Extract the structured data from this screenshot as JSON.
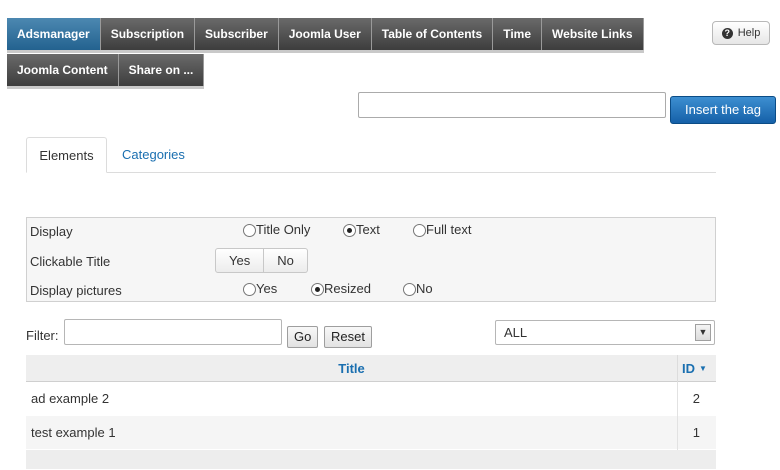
{
  "plugin_tabs": {
    "row1": [
      "Adsmanager",
      "Subscription",
      "Subscriber",
      "Joomla User",
      "Table of Contents",
      "Time",
      "Website Links"
    ],
    "row2": [
      "Joomla Content",
      "Share on ..."
    ],
    "active": "Adsmanager"
  },
  "help": {
    "label": "Help",
    "icon": "question-icon"
  },
  "tag_input": {
    "value": "",
    "placeholder": ""
  },
  "insert_button": {
    "label": "Insert the tag"
  },
  "subtabs": {
    "elements": "Elements",
    "categories": "Categories"
  },
  "options": {
    "display": {
      "label": "Display",
      "choices": [
        "Title Only",
        "Text",
        "Full text"
      ],
      "selected": "Text"
    },
    "clickable_title": {
      "label": "Clickable Title",
      "yes": "Yes",
      "no": "No"
    },
    "display_pictures": {
      "label": "Display pictures",
      "choices": [
        "Yes",
        "Resized",
        "No"
      ],
      "selected": "Resized"
    }
  },
  "filter": {
    "label": "Filter:",
    "value": "",
    "go": "Go",
    "reset": "Reset",
    "select_value": "ALL"
  },
  "table": {
    "headers": {
      "title": "Title",
      "id": "ID"
    },
    "rows": [
      {
        "title": "ad example 2",
        "id": "2"
      },
      {
        "title": "test example 1",
        "id": "1"
      }
    ]
  },
  "colors": {
    "active_tab": "#23628f",
    "link": "#1a6fb0",
    "primary_button": "#1560a8"
  }
}
